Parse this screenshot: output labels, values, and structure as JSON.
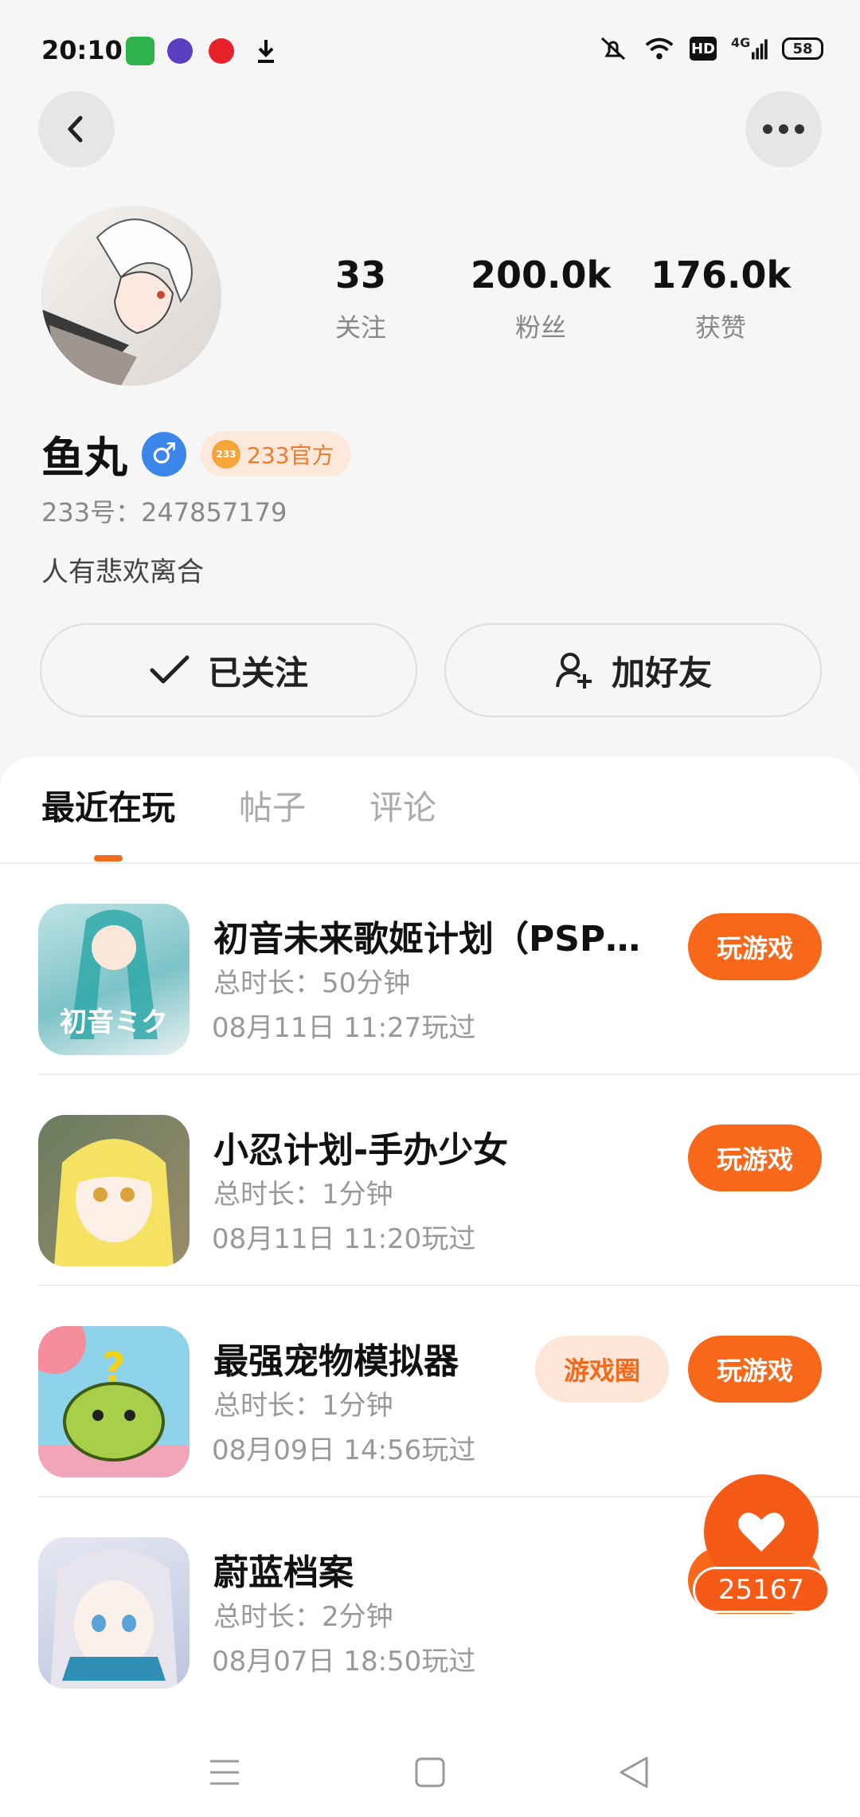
{
  "status_bar": {
    "time": "20:10",
    "battery": "58",
    "network": "4G",
    "hd_label": "HD"
  },
  "profile": {
    "name": "鱼丸",
    "gender_symbol": "♂",
    "official_badge": "233官方",
    "official_logo_text": "233",
    "id": "233号：247857179",
    "bio": "人有悲欢离合",
    "stats": [
      {
        "value": "33",
        "label": "关注"
      },
      {
        "value": "200.0k",
        "label": "粉丝"
      },
      {
        "value": "176.0k",
        "label": "获赞"
      }
    ],
    "followed_label": "已关注",
    "add_friend_label": "加好友"
  },
  "tabs": [
    {
      "label": "最近在玩",
      "active": true
    },
    {
      "label": "帖子",
      "active": false
    },
    {
      "label": "评论",
      "active": false
    }
  ],
  "games": [
    {
      "title": "初音未来歌姬计划（PSP…",
      "duration": "总时长：50分钟",
      "last_played": "08月11日 11:27玩过",
      "play_label": "玩游戏",
      "icon_text": "初音ミク"
    },
    {
      "title": "小忍计划-手办少女",
      "duration": "总时长：1分钟",
      "last_played": "08月11日 11:20玩过",
      "play_label": "玩游戏"
    },
    {
      "title": "最强宠物模拟器",
      "duration": "总时长：1分钟",
      "last_played": "08月09日 14:56玩过",
      "play_label": "玩游戏",
      "circle_label": "游戏圈"
    },
    {
      "title": "蔚蓝档案",
      "duration": "总时长：2分钟",
      "last_played": "08月07日 18:50玩过",
      "play_label": "玩游戏"
    }
  ],
  "like": {
    "count": "25167"
  },
  "colors": {
    "accent": "#f7681a",
    "gender": "#3b86e8",
    "badge_bg": "#fde8dc"
  }
}
